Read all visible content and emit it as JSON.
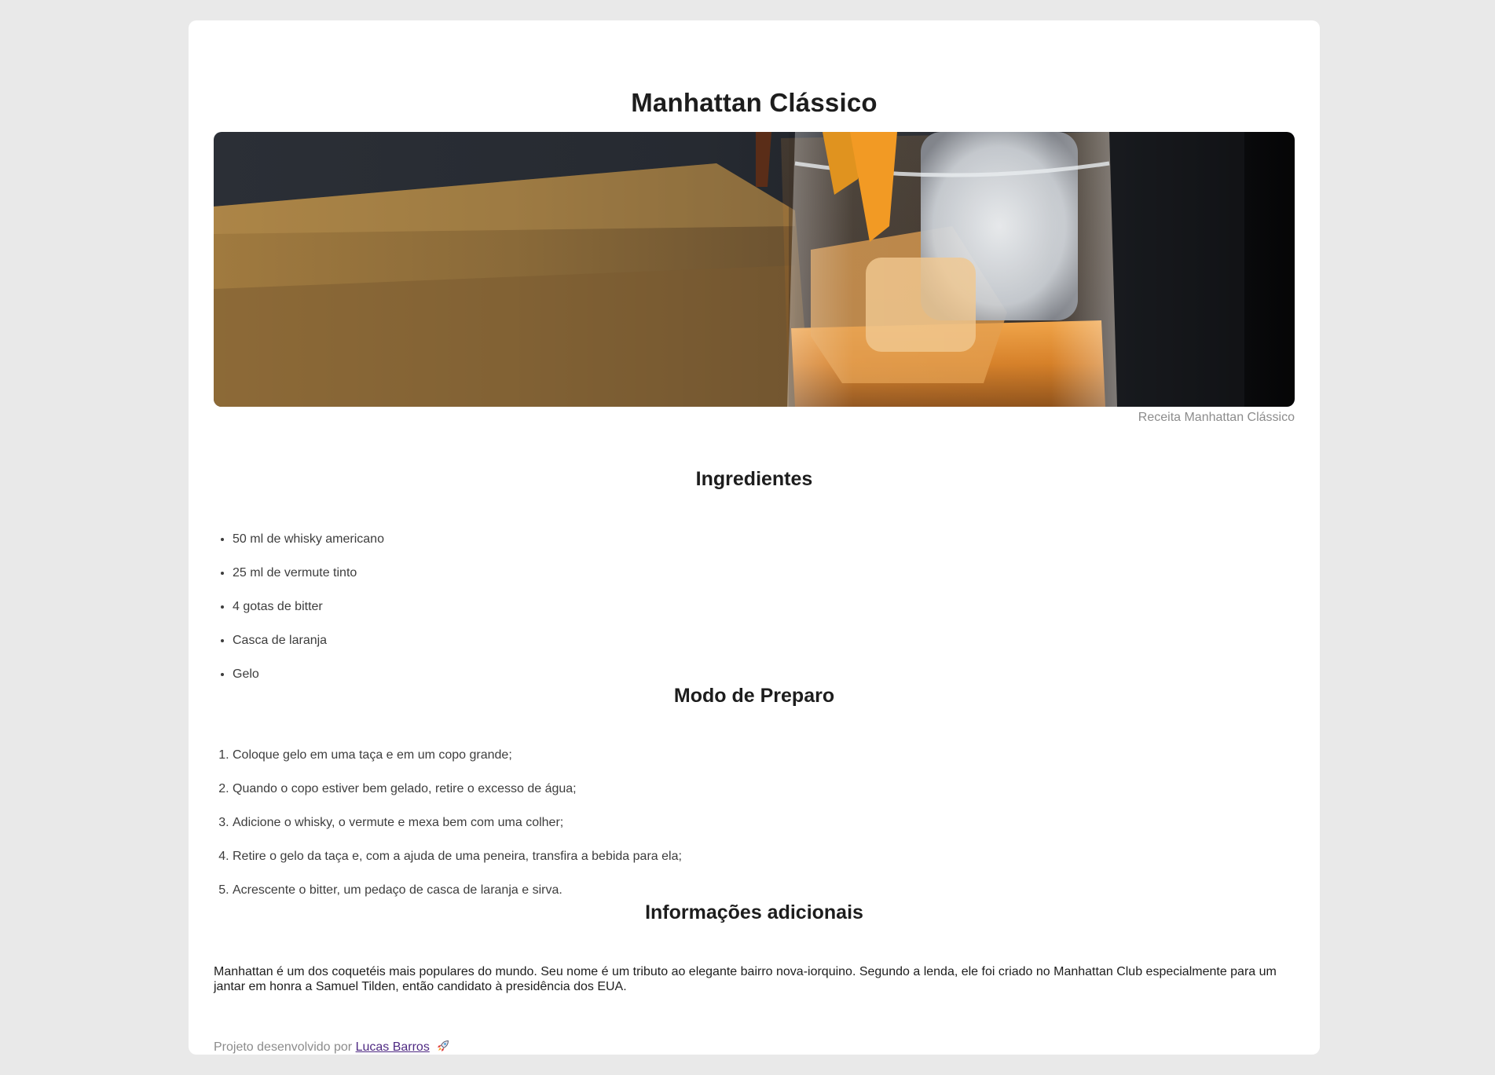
{
  "recipe": {
    "title": "Manhattan Clássico",
    "image_caption": "Receita Manhattan Clássico"
  },
  "ingredients": {
    "heading": "Ingredientes",
    "items": [
      "50 ml de whisky americano",
      "25 ml de vermute tinto",
      "4 gotas de bitter",
      "Casca de laranja",
      "Gelo"
    ]
  },
  "preparation": {
    "heading": "Modo de Preparo",
    "steps": [
      "Coloque gelo em uma taça e em um copo grande;",
      "Quando o copo estiver bem gelado, retire o excesso de água;",
      "Adicione o whisky, o vermute e mexa bem com uma colher;",
      "Retire o gelo da taça e, com a ajuda de uma peneira, transfira a bebida para ela;",
      "Acrescente o bitter, um pedaço de casca de laranja e sirva."
    ]
  },
  "info": {
    "heading": "Informações adicionais",
    "text": "Manhattan é um dos coquetéis mais populares do mundo. Seu nome é um tributo ao elegante bairro nova-iorquino. Segundo a lenda, ele foi criado no Manhattan Club especialmente para um jantar em honra a Samuel Tilden, então candidato à presidência dos EUA."
  },
  "footer": {
    "prefix": "Projeto desenvolvido por",
    "author": "Lucas Barros",
    "icon": "rocket-icon"
  },
  "colors": {
    "page_background": "#e9e9e9",
    "card_background": "#ffffff",
    "link": "#4f2a83"
  }
}
